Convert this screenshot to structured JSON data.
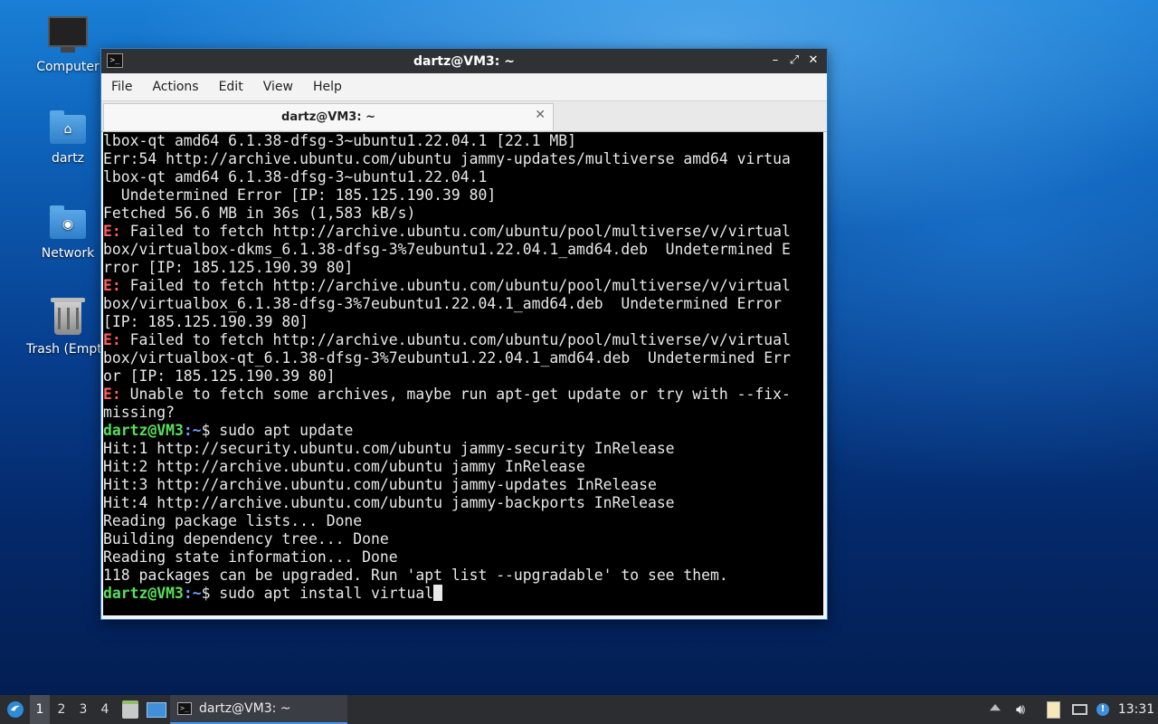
{
  "desktop": {
    "icons": [
      {
        "label": "Computer"
      },
      {
        "label": "dartz"
      },
      {
        "label": "Network"
      },
      {
        "label": "Trash (Empt"
      }
    ]
  },
  "window": {
    "title": "dartz@VM3: ~",
    "controls": {
      "minimize": "–",
      "maximize": "⤢",
      "close": "✕"
    },
    "menu": [
      "File",
      "Actions",
      "Edit",
      "View",
      "Help"
    ],
    "tab": {
      "label": "dartz@VM3: ~",
      "close": "✕"
    }
  },
  "terminal": {
    "lines": [
      {
        "text": "lbox-qt amd64 6.1.38-dfsg-3~ubuntu1.22.04.1 [22.1 MB]"
      },
      {
        "text": "Err:54 http://archive.ubuntu.com/ubuntu jammy-updates/multiverse amd64 virtua"
      },
      {
        "text": "lbox-qt amd64 6.1.38-dfsg-3~ubuntu1.22.04.1"
      },
      {
        "text": "  Undetermined Error [IP: 185.125.190.39 80]"
      },
      {
        "text": "Fetched 56.6 MB in 36s (1,583 kB/s)"
      },
      {
        "prefix": "E:",
        "text": " Failed to fetch http://archive.ubuntu.com/ubuntu/pool/multiverse/v/virtual"
      },
      {
        "text": "box/virtualbox-dkms_6.1.38-dfsg-3%7eubuntu1.22.04.1_amd64.deb  Undetermined E"
      },
      {
        "text": "rror [IP: 185.125.190.39 80]"
      },
      {
        "prefix": "E:",
        "text": " Failed to fetch http://archive.ubuntu.com/ubuntu/pool/multiverse/v/virtual"
      },
      {
        "text": "box/virtualbox_6.1.38-dfsg-3%7eubuntu1.22.04.1_amd64.deb  Undetermined Error"
      },
      {
        "text": "[IP: 185.125.190.39 80]"
      },
      {
        "prefix": "E:",
        "text": " Failed to fetch http://archive.ubuntu.com/ubuntu/pool/multiverse/v/virtual"
      },
      {
        "text": "box/virtualbox-qt_6.1.38-dfsg-3%7eubuntu1.22.04.1_amd64.deb  Undetermined Err"
      },
      {
        "text": "or [IP: 185.125.190.39 80]"
      },
      {
        "prefix": "E:",
        "text": " Unable to fetch some archives, maybe run apt-get update or try with --fix-"
      },
      {
        "text": "missing?"
      },
      {
        "prompt_user": "dartz@VM3",
        "prompt_path": ":~",
        "text": "$ sudo apt update"
      },
      {
        "text": "Hit:1 http://security.ubuntu.com/ubuntu jammy-security InRelease"
      },
      {
        "text": "Hit:2 http://archive.ubuntu.com/ubuntu jammy InRelease"
      },
      {
        "text": "Hit:3 http://archive.ubuntu.com/ubuntu jammy-updates InRelease"
      },
      {
        "text": "Hit:4 http://archive.ubuntu.com/ubuntu jammy-backports InRelease"
      },
      {
        "text": "Reading package lists... Done"
      },
      {
        "text": "Building dependency tree... Done"
      },
      {
        "text": "Reading state information... Done"
      },
      {
        "text": "118 packages can be upgraded. Run 'apt list --upgradable' to see them."
      },
      {
        "prompt_user": "dartz@VM3",
        "prompt_path": ":~",
        "text": "$ sudo apt install virtual",
        "cursor": true
      }
    ]
  },
  "taskbar": {
    "workspaces": [
      "1",
      "2",
      "3",
      "4"
    ],
    "task": {
      "label": "dartz@VM3: ~"
    },
    "clock": "13:31"
  },
  "colors": {
    "error": "#ff5c5c",
    "prompt_user": "#58e05a",
    "prompt_path": "#6fa0ff",
    "accent": "#4a90e2"
  }
}
